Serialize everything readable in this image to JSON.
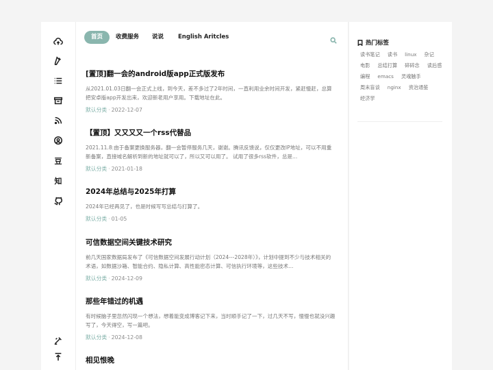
{
  "rail": {
    "icons": [
      "cloud-upload-icon",
      "document-edit-icon",
      "list-icon",
      "archive-icon",
      "rss-icon",
      "user-icon",
      "douban-icon",
      "zhihu-icon",
      "github-icon"
    ],
    "douban_glyph": "豆",
    "zhihu_glyph": "知",
    "bottom_icons": [
      "theme-toggle-icon",
      "back-to-top-icon"
    ]
  },
  "nav": {
    "tabs": [
      "首页",
      "收费服务",
      "说说",
      "English Aritcles"
    ],
    "active": "首页"
  },
  "posts": [
    {
      "title": "[置顶]翻一会的android版app正式版发布",
      "excerpt": "从2021.01.03日翻一会正式上线，到今天，差不多过了2年时间，一直利用业余时间开发，紧赶慢赶，总算把安卓版app开发出来，欢迎新老用户享用。下载地址在此。",
      "category": "默认分类",
      "date": "2022-12-07"
    },
    {
      "title": "【置顶】又又又又一个rss代替品",
      "excerpt": "2021.11.8:由于备案更换服务器，翻一会暂停服务几天，谢谢。腾讯反馈说，仅仅更改IP地址，可以不用重新备案，直接域名解析到新的地址就可以了，所以又可以用了。 试用了很多rss软件，总是...",
      "category": "默认分类",
      "date": "2021-01-18"
    },
    {
      "title": "2024年总结与2025年打算",
      "excerpt": "2024年已经再见了，也是时候写写总结与打算了。",
      "category": "默认分类",
      "date": "01-05"
    },
    {
      "title": "可信数据空间关键技术研究",
      "excerpt": "前几天国家数据局发布了《可信数据空间发展行动计划（2024---2028年）》，计划中提到不少与技术相关的术语，如数据沙箱、智能合约、隐私计算、高性能密态计算、可信执行环境等，这些技术...",
      "category": "默认分类",
      "date": "2024-12-09"
    },
    {
      "title": "那些年错过的机遇",
      "excerpt": "有时候脑子里忽然闪现一个想法，想着能变成博客记下来，当时顺手记了一下，过几天不写，慢慢也就没兴趣写了，今天得空，写一篇吧。",
      "category": "默认分类",
      "date": "2024-12-08"
    },
    {
      "title": "相见恨晚",
      "excerpt": "",
      "category": "",
      "date": ""
    }
  ],
  "meta_sep": "·",
  "sidebar": {
    "title": "热门标签",
    "tags": [
      "读书笔记",
      "读书",
      "linux",
      "杂记",
      "电影",
      "总结打算",
      "碎碎念",
      "读后感",
      "编程",
      "emacs",
      "灵魂触手",
      "周末盲谈",
      "nginx",
      "资治通鉴",
      "经济学"
    ]
  },
  "colors": {
    "accent": "#8ab6ae",
    "category": "#7fb0a8"
  }
}
